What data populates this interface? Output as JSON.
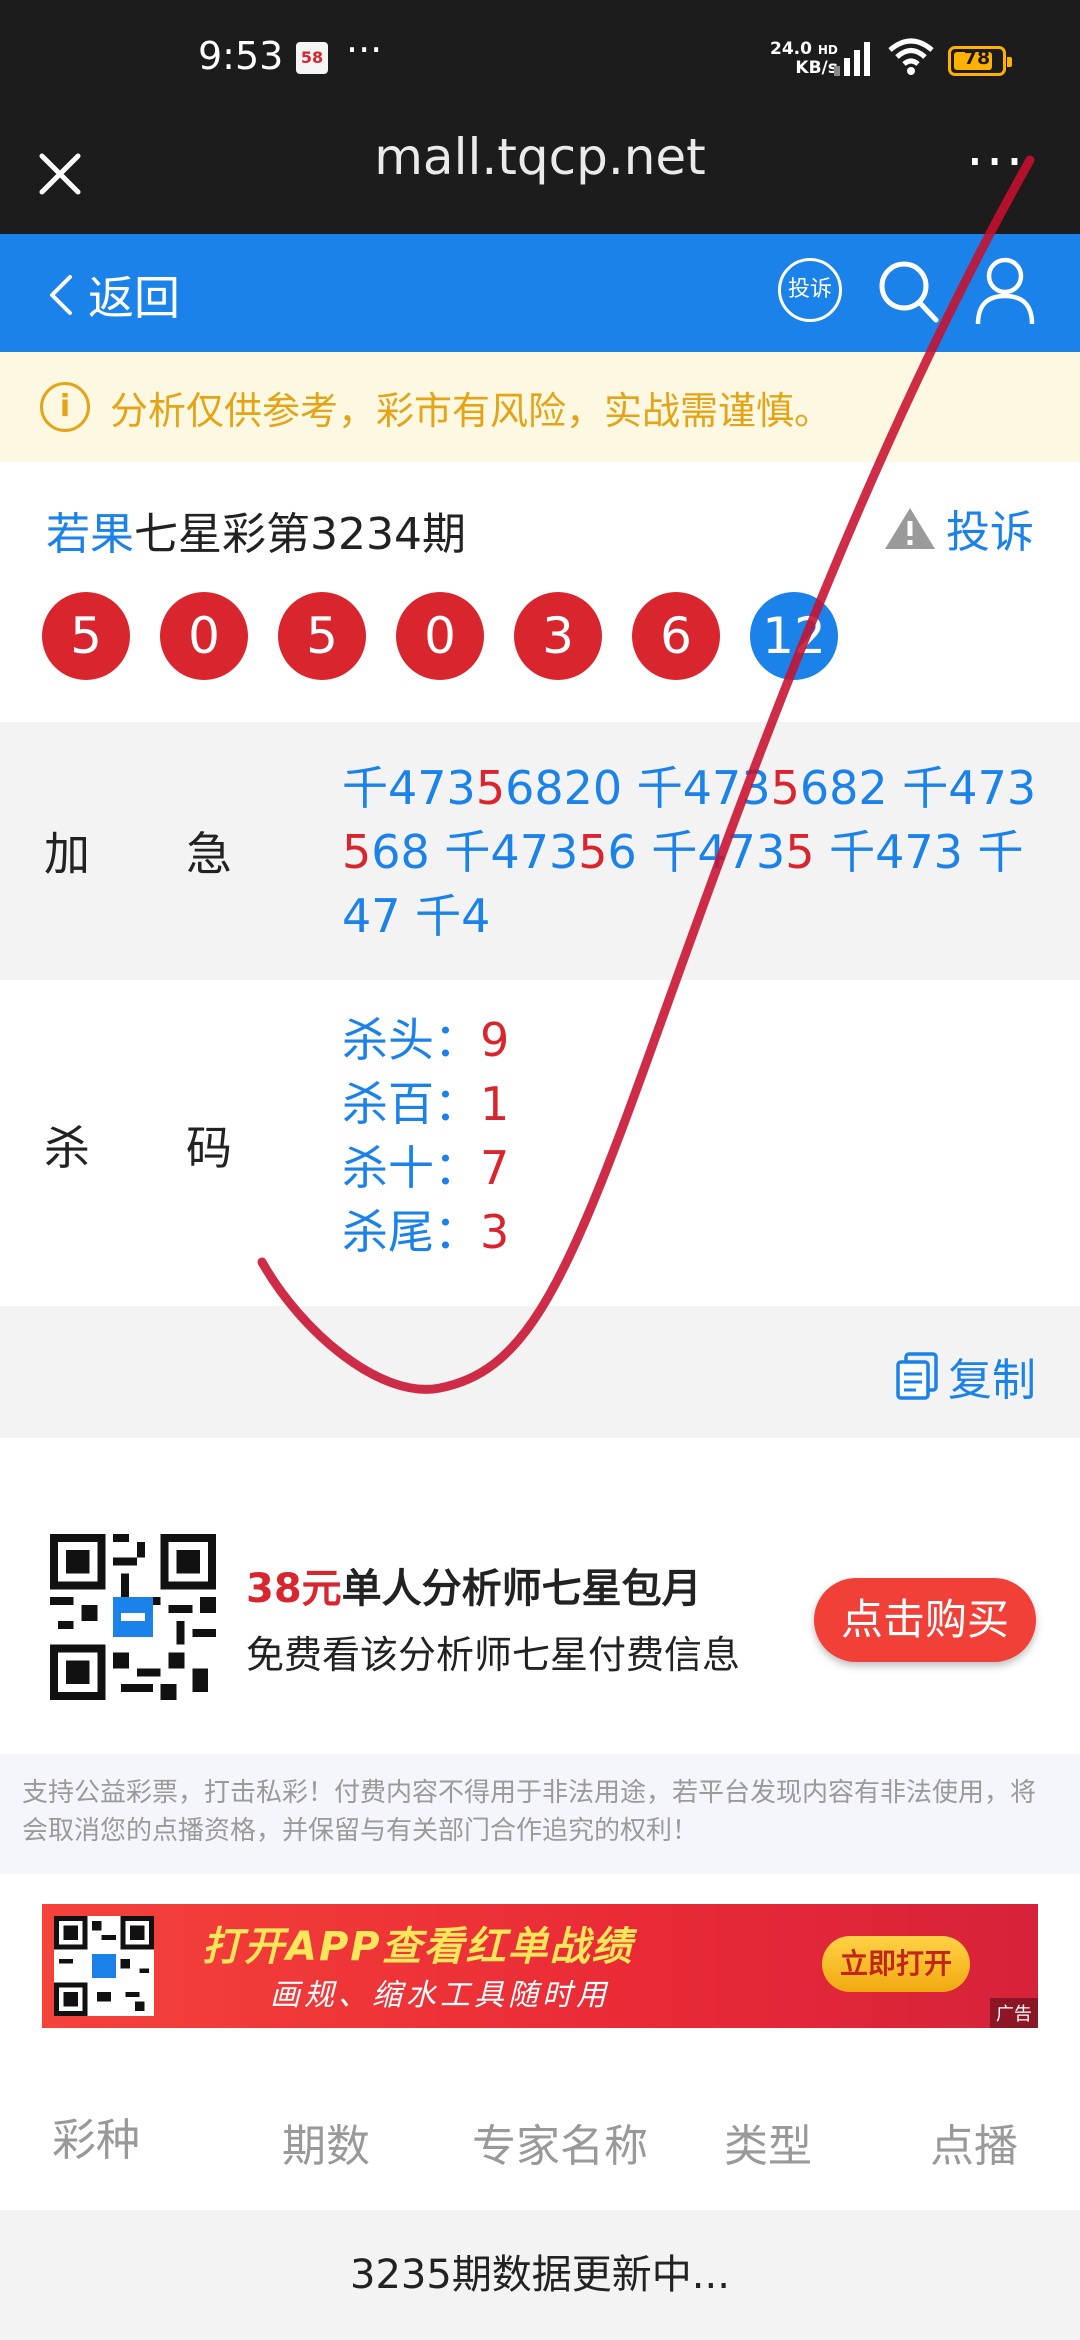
{
  "status_bar": {
    "time": "9:53",
    "app_badge": "58",
    "more": "···",
    "net_speed_value": "24.0",
    "net_speed_unit": "KB/s",
    "net_type": "HD",
    "battery_level": "78",
    "battery_color": "#ffb100"
  },
  "browser": {
    "url": "mall.tqcp.net",
    "more": "···"
  },
  "nav": {
    "back_label": "返回",
    "complain_badge": "投诉",
    "accent": "#1a82e8"
  },
  "notice": {
    "icon": "i",
    "text": "分析仅供参考，彩市有风险，实战需谨慎。"
  },
  "header": {
    "author": "若果",
    "title_rest": "七星彩第3234期",
    "report_label": "投诉",
    "balls": [
      "5",
      "0",
      "5",
      "0",
      "3",
      "6",
      "12"
    ]
  },
  "jiaji": {
    "label_a": "加",
    "label_b": "急",
    "segments": [
      {
        "t": "千473",
        "red": false
      },
      {
        "t": "5",
        "red": true
      },
      {
        "t": "6820 千473",
        "red": false
      },
      {
        "t": "5",
        "red": true
      },
      {
        "t": "682 千473 ",
        "red": false
      },
      {
        "t": "5",
        "red": true
      },
      {
        "t": "68 千473",
        "red": false
      },
      {
        "t": "5",
        "red": true
      },
      {
        "t": "6 千473",
        "red": false
      },
      {
        "t": "5",
        "red": true
      },
      {
        "t": " 千473 千47 千4",
        "red": false
      }
    ]
  },
  "shama": {
    "label_a": "杀",
    "label_b": "码",
    "items": [
      {
        "k": "杀头：",
        "v": "9"
      },
      {
        "k": "杀百：",
        "v": "1"
      },
      {
        "k": "杀十：",
        "v": "7"
      },
      {
        "k": "杀尾：",
        "v": "3"
      }
    ]
  },
  "copy_label": "复制",
  "promo": {
    "price": "38元",
    "title": "单人分析师七星包月",
    "subtitle": "免费看该分析师七星付费信息",
    "buy_label": "点击购买"
  },
  "disclaimer": "支持公益彩票，打击私彩！付费内容不得用于非法用途，若平台发现内容有非法使用，将会取消您的点播资格，并保留与有关部门合作追究的权利！",
  "banner": {
    "line1": "打开APP查看红单战绩",
    "line2": "画规、缩水工具随时用",
    "open_label": "立即打开",
    "ad_tag": "广告"
  },
  "table": {
    "headers": [
      "彩种",
      "期数",
      "专家名称",
      "类型",
      "点播"
    ],
    "status": "3235期数据更新中..."
  }
}
